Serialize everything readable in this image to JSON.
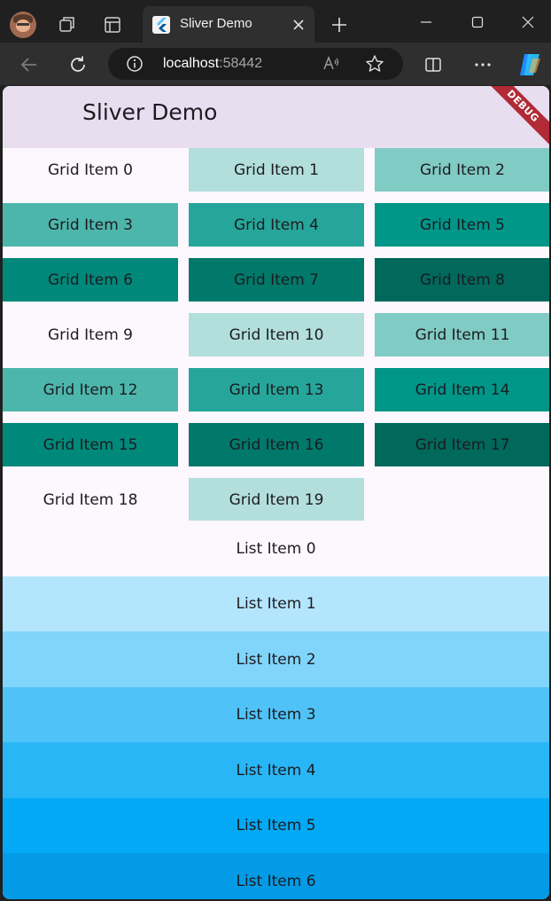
{
  "browser": {
    "tab_title": "Sliver Demo",
    "url_host": "localhost",
    "url_port": ":58442"
  },
  "app": {
    "title": "Sliver Demo",
    "debug_banner": "DEBUG"
  },
  "grid_items": [
    {
      "label": "Grid Item 0",
      "color": "#fdf7fe"
    },
    {
      "label": "Grid Item 1",
      "color": "#b2dfdb"
    },
    {
      "label": "Grid Item 2",
      "color": "#80cbc4"
    },
    {
      "label": "Grid Item 3",
      "color": "#4db6ac"
    },
    {
      "label": "Grid Item 4",
      "color": "#26a69a"
    },
    {
      "label": "Grid Item 5",
      "color": "#009688"
    },
    {
      "label": "Grid Item 6",
      "color": "#00897b"
    },
    {
      "label": "Grid Item 7",
      "color": "#00796b"
    },
    {
      "label": "Grid Item 8",
      "color": "#00695c"
    },
    {
      "label": "Grid Item 9",
      "color": "#fdf7fe"
    },
    {
      "label": "Grid Item 10",
      "color": "#b2dfdb"
    },
    {
      "label": "Grid Item 11",
      "color": "#80cbc4"
    },
    {
      "label": "Grid Item 12",
      "color": "#4db6ac"
    },
    {
      "label": "Grid Item 13",
      "color": "#26a69a"
    },
    {
      "label": "Grid Item 14",
      "color": "#009688"
    },
    {
      "label": "Grid Item 15",
      "color": "#00897b"
    },
    {
      "label": "Grid Item 16",
      "color": "#00796b"
    },
    {
      "label": "Grid Item 17",
      "color": "#00695c"
    },
    {
      "label": "Grid Item 18",
      "color": "#fdf7fe"
    },
    {
      "label": "Grid Item 19",
      "color": "#b2dfdb"
    }
  ],
  "list_items": [
    {
      "label": "List Item 0",
      "color": "#fdf7fe"
    },
    {
      "label": "List Item 1",
      "color": "#b3e5fc"
    },
    {
      "label": "List Item 2",
      "color": "#81d4fa"
    },
    {
      "label": "List Item 3",
      "color": "#4fc3f7"
    },
    {
      "label": "List Item 4",
      "color": "#29b6f6"
    },
    {
      "label": "List Item 5",
      "color": "#03a9f4"
    },
    {
      "label": "List Item 6",
      "color": "#039be5"
    }
  ]
}
